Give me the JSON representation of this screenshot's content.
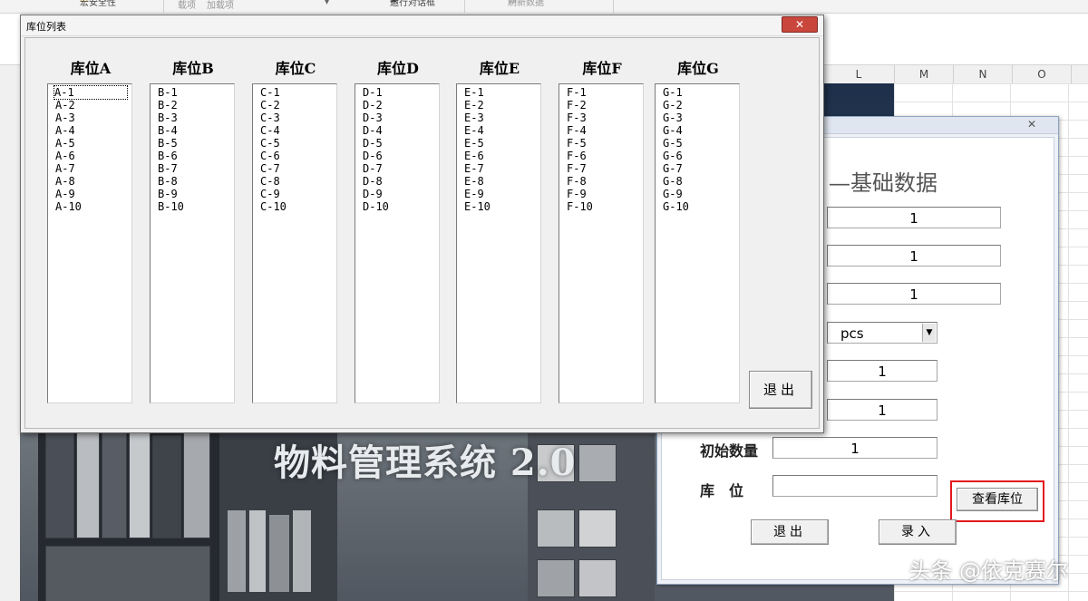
{
  "ribbon": {
    "items": [
      {
        "label": "宏安全性",
        "icon": "warning-icon"
      },
      {
        "label": "载项"
      },
      {
        "label": "加载项"
      },
      {
        "label": "▾"
      },
      {
        "label": "运行对话框",
        "icon": "dialog-icon"
      },
      {
        "label": "刷新数据",
        "icon": "refresh-icon"
      }
    ]
  },
  "sheet": {
    "columns": [
      "L",
      "M",
      "N",
      "O"
    ]
  },
  "splash": {
    "title": "物料管理系统 2.0"
  },
  "data_dialog": {
    "close_label": "✕",
    "heading": "基础数据",
    "fields": [
      "1",
      "1",
      "1"
    ],
    "unit_value": "pcs",
    "field4": "1",
    "field5": "1",
    "initial_qty_label": "初始数量",
    "initial_qty_value": "1",
    "location_label": "库　位",
    "location_value": "",
    "view_location_label": "查看库位",
    "exit_label": "退出",
    "save_label": "录入"
  },
  "location_dialog": {
    "title": "库位列表",
    "close_label": "✕",
    "exit_label": "退出",
    "columns": [
      {
        "header": "库位A",
        "items": [
          "A-1",
          "A-2",
          "A-3",
          "A-4",
          "A-5",
          "A-6",
          "A-7",
          "A-8",
          "A-9",
          "A-10"
        ]
      },
      {
        "header": "库位B",
        "items": [
          "B-1",
          "B-2",
          "B-3",
          "B-4",
          "B-5",
          "B-6",
          "B-7",
          "B-8",
          "B-9",
          "B-10"
        ]
      },
      {
        "header": "库位C",
        "items": [
          "C-1",
          "C-2",
          "C-3",
          "C-4",
          "C-5",
          "C-6",
          "C-7",
          "C-8",
          "C-9",
          "C-10"
        ]
      },
      {
        "header": "库位D",
        "items": [
          "D-1",
          "D-2",
          "D-3",
          "D-4",
          "D-5",
          "D-6",
          "D-7",
          "D-8",
          "D-9",
          "D-10"
        ]
      },
      {
        "header": "库位E",
        "items": [
          "E-1",
          "E-2",
          "E-3",
          "E-4",
          "E-5",
          "E-6",
          "E-7",
          "E-8",
          "E-9",
          "E-10"
        ]
      },
      {
        "header": "库位F",
        "items": [
          "F-1",
          "F-2",
          "F-3",
          "F-4",
          "F-5",
          "F-6",
          "F-7",
          "F-8",
          "F-9",
          "F-10"
        ]
      },
      {
        "header": "库位G",
        "items": [
          "G-1",
          "G-2",
          "G-3",
          "G-4",
          "G-5",
          "G-6",
          "G-7",
          "G-8",
          "G-9",
          "G-10"
        ]
      }
    ]
  },
  "watermark": "头条 @依克赛尔"
}
